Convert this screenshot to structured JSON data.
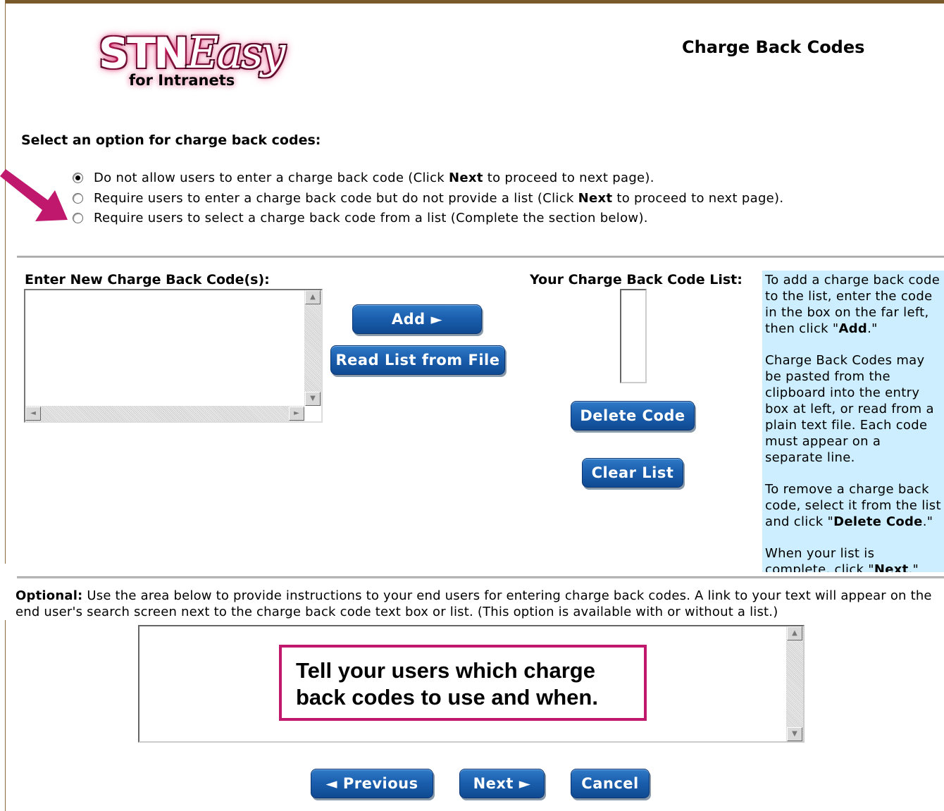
{
  "logo": {
    "brand_main": "STN",
    "brand_easy": "Easy",
    "brand_sub": "for Intranets"
  },
  "page_title": "Charge Back Codes",
  "options": {
    "label": "Select an option for charge back codes:",
    "items": [
      {
        "pre": "Do not allow users to enter a charge back code (Click ",
        "bold": "Next",
        "post": " to proceed to next page).",
        "checked": true
      },
      {
        "pre": "Require users to enter a charge back code but do not provide a list (Click ",
        "bold": "Next",
        "post": " to proceed to next page).",
        "checked": false
      },
      {
        "pre": "Require users to select a charge back code from a list (Complete the section below).",
        "bold": "",
        "post": "",
        "checked": false
      }
    ]
  },
  "entry": {
    "label": "Enter New Charge Back Code(s):",
    "value": ""
  },
  "buttons": {
    "add": "Add ►",
    "read_file": "Read List from File",
    "delete": "Delete Code",
    "clear": "Clear List",
    "previous": "◄ Previous",
    "next": "Next ►",
    "cancel": "Cancel"
  },
  "list": {
    "label": "Your Charge Back Code List:"
  },
  "help": {
    "p1_pre": "To add a charge back code to the list, enter the code in the box on the far left, then click \"",
    "p1_bold": "Add",
    "p1_post": ".\"",
    "p2": "Charge Back Codes may be pasted from the clipboard into the entry box at left, or read from a plain text file. Each code must appear on a separate line.",
    "p3_pre": "To remove a charge back code, select it from the list and click \"",
    "p3_bold": "Delete Code",
    "p3_post": ".\"",
    "p4_pre": "When your list is complete, click \"",
    "p4_bold": "Next",
    "p4_post": ".\""
  },
  "optional": {
    "bold": "Optional:",
    "text": " Use the area below to provide instructions to your end users for entering charge back codes. A link to your text will appear on the end user's search screen next to the charge back code text box or list. (This option is available with or without a list.)"
  },
  "callout": {
    "text": "Tell your users which charge back codes to use and when."
  },
  "colors": {
    "button_blue": "#1b5fae",
    "help_bg": "#cceeff",
    "callout_border": "#c0186c",
    "arrow": "#c0186c"
  }
}
